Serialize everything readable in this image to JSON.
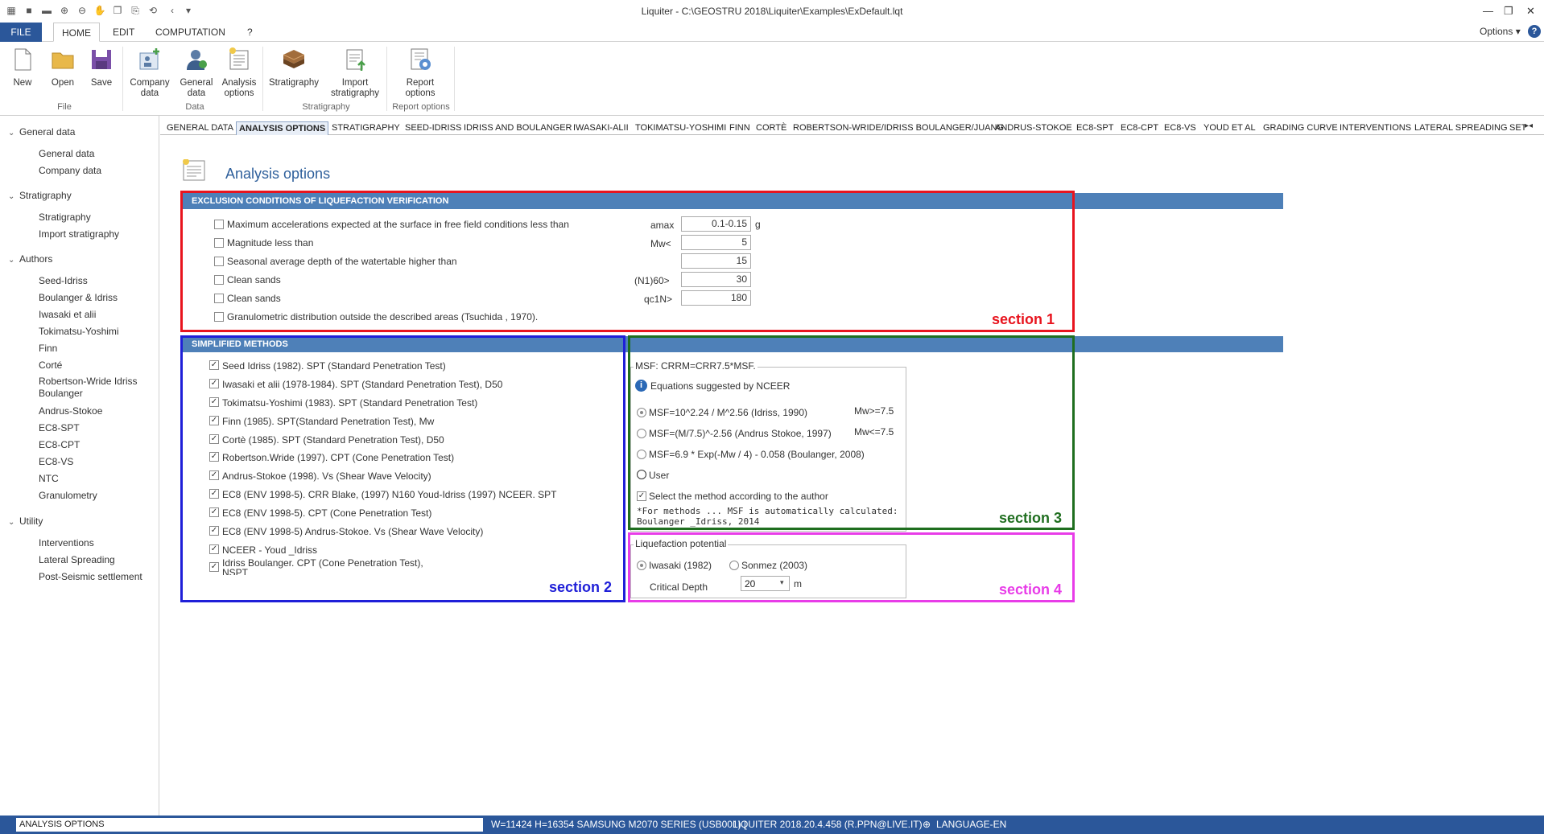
{
  "window": {
    "title": "Liquiter - C:\\GEOSTRU 2018\\Liquiter\\Examples\\ExDefault.lqt",
    "options_label": "Options"
  },
  "menu": {
    "file": "FILE",
    "home": "HOME",
    "edit": "EDIT",
    "computation": "COMPUTATION",
    "help": "?"
  },
  "ribbon": {
    "new": "New",
    "open": "Open",
    "save": "Save",
    "company_data": [
      "Company",
      "data"
    ],
    "general_data": [
      "General",
      "data"
    ],
    "analysis_options": [
      "Analysis",
      "options"
    ],
    "stratigraphy": "Stratigraphy",
    "import_stratigraphy": [
      "Import",
      "stratigraphy"
    ],
    "report_options": [
      "Report",
      "options"
    ],
    "groups": {
      "file": "File",
      "data": "Data",
      "stratigraphy": "Stratigraphy",
      "report": "Report options"
    }
  },
  "sidebar": {
    "groups": [
      {
        "label": "General data",
        "items": [
          "General data",
          "Company data"
        ]
      },
      {
        "label": "Stratigraphy",
        "items": [
          "Stratigraphy",
          "Import stratigraphy"
        ]
      },
      {
        "label": "Authors",
        "items": [
          "Seed-Idriss",
          "Boulanger & Idriss",
          "Iwasaki et alii",
          "Tokimatsu-Yoshimi",
          "Finn",
          "Corté",
          "Robertson-Wride Idriss Boulanger",
          "Andrus-Stokoe",
          "EC8-SPT",
          "EC8-CPT",
          "EC8-VS",
          "NTC",
          "Granulometry"
        ]
      },
      {
        "label": "Utility",
        "items": [
          "Interventions",
          "Lateral Spreading",
          "Post-Seismic settlement"
        ]
      }
    ]
  },
  "tabs": [
    "GENERAL DATA",
    "ANALYSIS OPTIONS",
    "STRATIGRAPHY",
    "SEED-IDRISS",
    "IDRISS AND BOULANGER",
    "IWASAKI-ALII",
    "TOKIMATSU-YOSHIMI",
    "FINN",
    "CORTÈ",
    "ROBERTSON-WRIDE/IDRISS BOULANGER/JUANG",
    "ANDRUS-STOKOE",
    "EC8-SPT",
    "EC8-CPT",
    "EC8-VS",
    "YOUD ET AL",
    "GRADING CURVE",
    "INTERVENTIONS",
    "LATERAL SPREADING",
    "SET"
  ],
  "page": {
    "title": "Analysis options"
  },
  "exclusion": {
    "header": "EXCLUSION CONDITIONS OF LIQUEFACTION VERIFICATION",
    "rows": [
      {
        "label": "Maximum accelerations expected at the surface in free field conditions less than",
        "param": "amax",
        "value": "0.1-0.15",
        "unit": "g"
      },
      {
        "label": "Magnitude less than",
        "param": "Mw<",
        "value": "5"
      },
      {
        "label": "Seasonal average depth of the watertable higher than",
        "param": "",
        "value": "15"
      },
      {
        "label": "Clean sands",
        "param": "(N1)60>",
        "value": "30"
      },
      {
        "label": "Clean sands",
        "param": "qc1N>",
        "value": "180"
      },
      {
        "label": "Granulometric distribution outside the described areas (Tsuchida , 1970)."
      }
    ]
  },
  "simplified": {
    "header": "SIMPLIFIED METHODS",
    "items": [
      "Seed Idriss (1982). SPT (Standard Penetration Test)",
      "Iwasaki et alii (1978-1984). SPT (Standard Penetration Test), D50",
      "Tokimatsu-Yoshimi (1983). SPT (Standard Penetration Test)",
      "Finn (1985). SPT(Standard Penetration Test), Mw",
      "Cortè (1985). SPT (Standard Penetration Test), D50",
      "Robertson.Wride (1997). CPT (Cone Penetration Test)",
      "Andrus-Stokoe (1998). Vs (Shear Wave Velocity)",
      "EC8 (ENV 1998-5). CRR Blake, (1997) N160 Youd-Idriss (1997) NCEER. SPT",
      "EC8 (ENV 1998-5). CPT (Cone Penetration Test)",
      "EC8 (ENV 1998-5) Andrus-Stokoe. Vs (Shear Wave Velocity)",
      "NCEER - Youd _Idriss"
    ],
    "last_item": [
      "Idriss Boulanger. CPT (Cone Penetration Test),",
      "NSPT"
    ]
  },
  "msf": {
    "legend": "MSF: CRRM=CRR7.5*MSF.",
    "info": "Equations suggested by NCEER",
    "options": [
      "MSF=10^2.24 / M^2.56 (Idriss, 1990)",
      "MSF=(M/7.5)^-2.56 (Andrus Stokoe, 1997)",
      "MSF=6.9 * Exp(-Mw / 4) - 0.058 (Boulanger, 2008)"
    ],
    "cond1": "Mw>=7.5",
    "cond2": "Mw<=7.5",
    "user": "User",
    "select_author": "Select the method according to the author",
    "note1": "*For methods ... MSF is automatically calculated:",
    "note2": "Boulanger _Idriss, 2014"
  },
  "potential": {
    "legend": "Liquefaction potential",
    "opt1": "Iwasaki (1982)",
    "opt2": "Sonmez (2003)",
    "critical_label": "Critical Depth",
    "critical_value": "20",
    "unit": "m"
  },
  "sections": {
    "s1": "section 1",
    "s2": "section 2",
    "s3": "section 3",
    "s4": "section 4"
  },
  "colors": {
    "s1": "#e8141e",
    "s2": "#1f1fd8",
    "s3": "#1f6e1f",
    "s4": "#e83ce8",
    "header": "#4e80b8",
    "statusbar": "#2b579a"
  },
  "status": {
    "left": "ANALYSIS OPTIONS",
    "printer": "W=11424 H=16354 SAMSUNG M2070 SERIES (USB001) |",
    "version": "LIQUITER 2018.20.4.458 (R.PPN@LIVE.IT)",
    "language": "LANGUAGE-EN"
  }
}
